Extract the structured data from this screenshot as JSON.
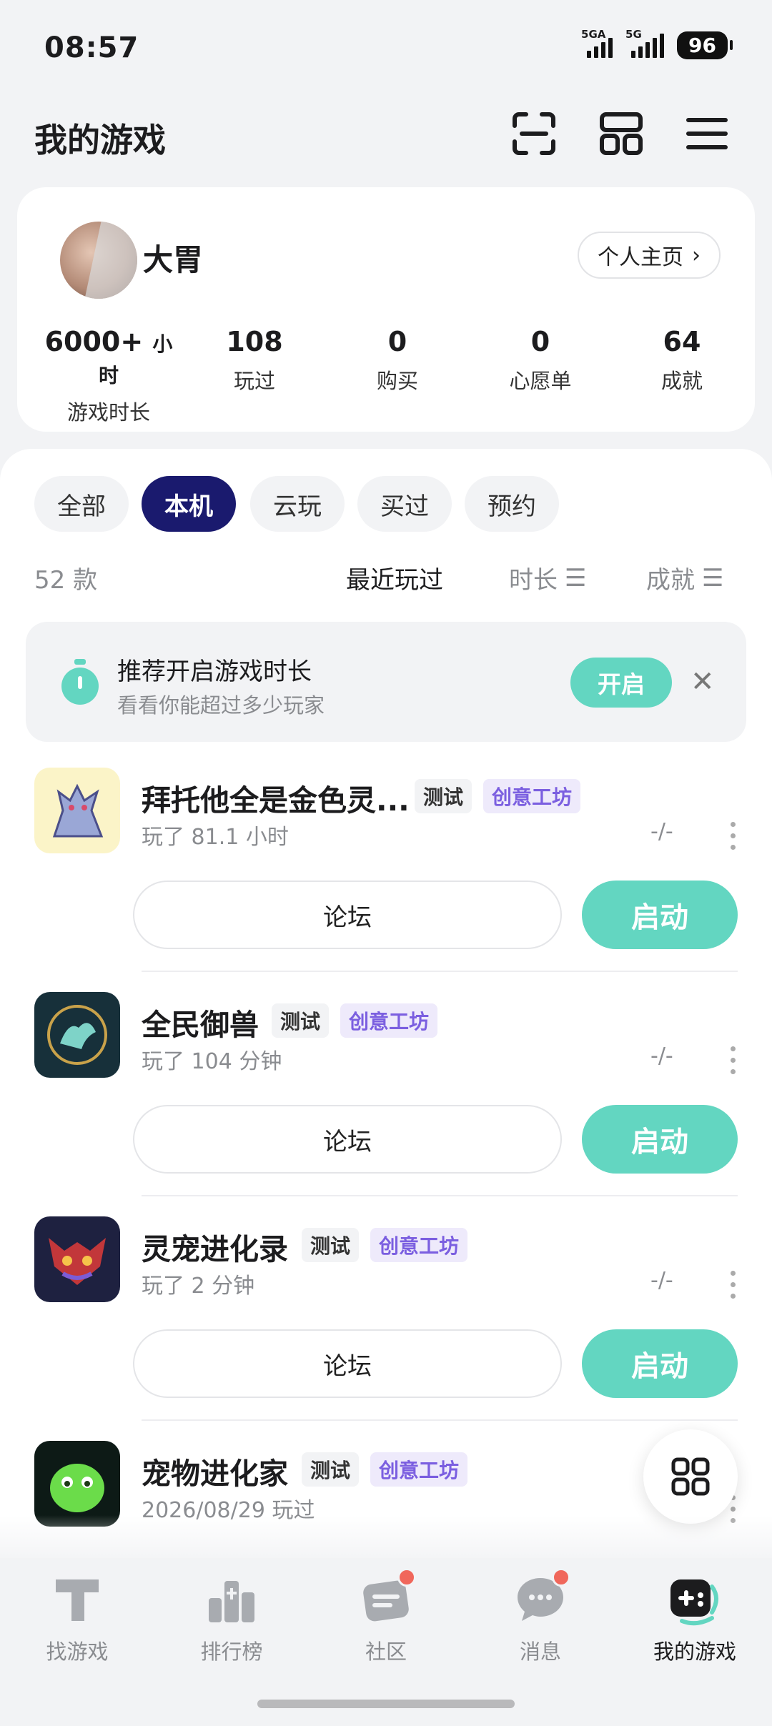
{
  "status_bar": {
    "time": "08:57",
    "signal1": "5GA",
    "signal2": "5G",
    "battery": "96"
  },
  "header": {
    "title": "我的游戏"
  },
  "profile": {
    "name": "大胃",
    "homepage_label": "个人主页",
    "stats": [
      {
        "value": "6000+",
        "unit": "小时",
        "label": "游戏时长"
      },
      {
        "value": "108",
        "label": "玩过"
      },
      {
        "value": "0",
        "label": "购买"
      },
      {
        "value": "0",
        "label": "心愿单"
      },
      {
        "value": "64",
        "label": "成就"
      }
    ]
  },
  "filters": {
    "tabs": [
      "全部",
      "本机",
      "云玩",
      "买过",
      "预约"
    ],
    "active": "本机"
  },
  "list_header": {
    "count": "52 款",
    "sort_recent": "最近玩过",
    "sort_time": "时长",
    "sort_achievement": "成就"
  },
  "recommend": {
    "title": "推荐开启游戏时长",
    "subtitle": "看看你能超过多少玩家",
    "button": "开启"
  },
  "games": [
    {
      "name": "拜托他全是金色灵...",
      "tag_test": "测试",
      "tag_workshop": "创意工坊",
      "meta": "玩了 81.1 小时",
      "dash": "-/-",
      "forum": "论坛",
      "launch": "启动"
    },
    {
      "name": "全民御兽",
      "tag_test": "测试",
      "tag_workshop": "创意工坊",
      "meta": "玩了 104 分钟",
      "dash": "-/-",
      "forum": "论坛",
      "launch": "启动"
    },
    {
      "name": "灵宠进化录",
      "tag_test": "测试",
      "tag_workshop": "创意工坊",
      "meta": "玩了 2 分钟",
      "dash": "-/-",
      "forum": "论坛",
      "launch": "启动"
    },
    {
      "name": "宠物进化家",
      "tag_test": "测试",
      "tag_workshop": "创意工坊",
      "meta": "2026/08/29 玩过"
    }
  ],
  "bottom_nav": [
    {
      "label": "找游戏",
      "icon": "find-games-icon"
    },
    {
      "label": "排行榜",
      "icon": "ranking-icon"
    },
    {
      "label": "社区",
      "icon": "community-icon",
      "badge": true
    },
    {
      "label": "消息",
      "icon": "message-icon",
      "badge": true
    },
    {
      "label": "我的游戏",
      "icon": "my-games-icon",
      "active": true
    }
  ],
  "colors": {
    "accent": "#63d6c1",
    "active_chip": "#1a1a6e",
    "workshop_tag": "#7b5fe0",
    "badge": "#f0675b"
  }
}
